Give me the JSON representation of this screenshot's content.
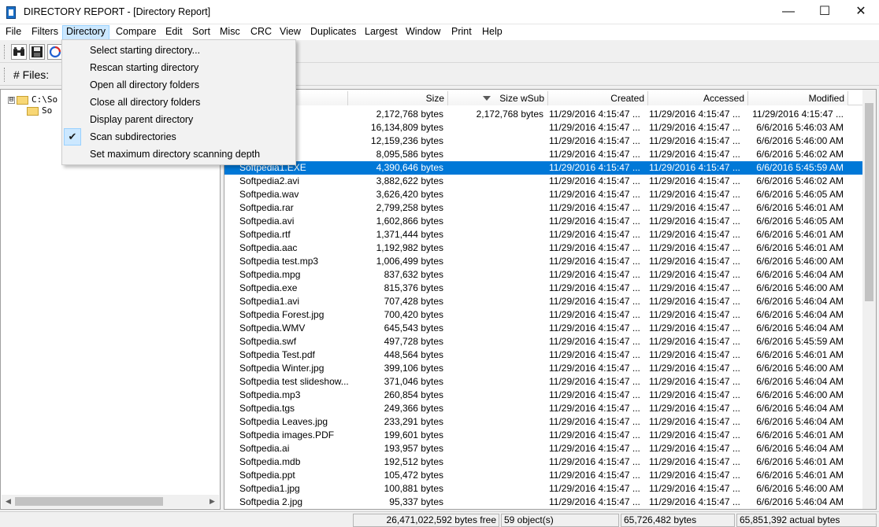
{
  "window": {
    "title": "DIRECTORY REPORT - [Directory Report]",
    "minimize": "—",
    "maximize": "☐",
    "close": "✕"
  },
  "menubar": {
    "items": [
      "File",
      "Filters",
      "Directory",
      "Compare",
      "Edit",
      "Sort",
      "Misc",
      "CRC",
      "View",
      "Duplicates",
      "Largest",
      "Window",
      "Print",
      "Help"
    ],
    "active": "Directory"
  },
  "toolbar": {
    "buttons": [
      "binoculars-icon",
      "save-icon",
      "refresh-icon"
    ]
  },
  "files_bar": {
    "label": "# Files:"
  },
  "directory_menu": {
    "items": [
      "Select starting directory...",
      "Rescan starting directory",
      "Open all directory folders",
      "Close all directory folders",
      "Display parent directory",
      "Scan subdirectories",
      "Set maximum directory scanning depth"
    ],
    "checked_item": "Scan subdirectories"
  },
  "tree": {
    "root": "C:\\So",
    "child": "So",
    "expander": "⊟"
  },
  "list": {
    "columns": [
      "Size",
      "Size wSub",
      "Created",
      "Accessed",
      "Modified"
    ],
    "sorted_column": "Size wSub",
    "selected_index": 4,
    "rows": [
      {
        "name": "",
        "size": "2,172,768 bytes",
        "sub": "2,172,768 bytes",
        "created": "11/29/2016 4:15:47 ...",
        "accessed": "11/29/2016 4:15:47 ...",
        "modified": "11/29/2016 4:15:47 ..."
      },
      {
        "name": "",
        "size": "16,134,809 bytes",
        "sub": "",
        "created": "11/29/2016 4:15:47 ...",
        "accessed": "11/29/2016 4:15:47 ...",
        "modified": "6/6/2016 5:46:03 AM"
      },
      {
        "name": "",
        "size": "12,159,236 bytes",
        "sub": "",
        "created": "11/29/2016 4:15:47 ...",
        "accessed": "11/29/2016 4:15:47 ...",
        "modified": "6/6/2016 5:46:00 AM"
      },
      {
        "name": "",
        "size": "8,095,586 bytes",
        "sub": "",
        "created": "11/29/2016 4:15:47 ...",
        "accessed": "11/29/2016 4:15:47 ...",
        "modified": "6/6/2016 5:46:02 AM"
      },
      {
        "name": "Softpedia1.EXE",
        "size": "4,390,646 bytes",
        "sub": "",
        "created": "11/29/2016 4:15:47 ...",
        "accessed": "11/29/2016 4:15:47 ...",
        "modified": "6/6/2016 5:45:59 AM"
      },
      {
        "name": "Softpedia2.avi",
        "size": "3,882,622 bytes",
        "sub": "",
        "created": "11/29/2016 4:15:47 ...",
        "accessed": "11/29/2016 4:15:47 ...",
        "modified": "6/6/2016 5:46:02 AM"
      },
      {
        "name": "Softpedia.wav",
        "size": "3,626,420 bytes",
        "sub": "",
        "created": "11/29/2016 4:15:47 ...",
        "accessed": "11/29/2016 4:15:47 ...",
        "modified": "6/6/2016 5:46:05 AM"
      },
      {
        "name": "Softpedia.rar",
        "size": "2,799,258 bytes",
        "sub": "",
        "created": "11/29/2016 4:15:47 ...",
        "accessed": "11/29/2016 4:15:47 ...",
        "modified": "6/6/2016 5:46:01 AM"
      },
      {
        "name": "Softpedia.avi",
        "size": "1,602,866 bytes",
        "sub": "",
        "created": "11/29/2016 4:15:47 ...",
        "accessed": "11/29/2016 4:15:47 ...",
        "modified": "6/6/2016 5:46:05 AM"
      },
      {
        "name": "Softpedia.rtf",
        "size": "1,371,444 bytes",
        "sub": "",
        "created": "11/29/2016 4:15:47 ...",
        "accessed": "11/29/2016 4:15:47 ...",
        "modified": "6/6/2016 5:46:01 AM"
      },
      {
        "name": "Softpedia.aac",
        "size": "1,192,982 bytes",
        "sub": "",
        "created": "11/29/2016 4:15:47 ...",
        "accessed": "11/29/2016 4:15:47 ...",
        "modified": "6/6/2016 5:46:01 AM"
      },
      {
        "name": "Softpedia test.mp3",
        "size": "1,006,499 bytes",
        "sub": "",
        "created": "11/29/2016 4:15:47 ...",
        "accessed": "11/29/2016 4:15:47 ...",
        "modified": "6/6/2016 5:46:00 AM"
      },
      {
        "name": "Softpedia.mpg",
        "size": "837,632 bytes",
        "sub": "",
        "created": "11/29/2016 4:15:47 ...",
        "accessed": "11/29/2016 4:15:47 ...",
        "modified": "6/6/2016 5:46:04 AM"
      },
      {
        "name": "Softpedia.exe",
        "size": "815,376 bytes",
        "sub": "",
        "created": "11/29/2016 4:15:47 ...",
        "accessed": "11/29/2016 4:15:47 ...",
        "modified": "6/6/2016 5:46:00 AM"
      },
      {
        "name": "Softpedia1.avi",
        "size": "707,428 bytes",
        "sub": "",
        "created": "11/29/2016 4:15:47 ...",
        "accessed": "11/29/2016 4:15:47 ...",
        "modified": "6/6/2016 5:46:04 AM"
      },
      {
        "name": "Softpedia Forest.jpg",
        "size": "700,420 bytes",
        "sub": "",
        "created": "11/29/2016 4:15:47 ...",
        "accessed": "11/29/2016 4:15:47 ...",
        "modified": "6/6/2016 5:46:04 AM"
      },
      {
        "name": "Softpedia.WMV",
        "size": "645,543 bytes",
        "sub": "",
        "created": "11/29/2016 4:15:47 ...",
        "accessed": "11/29/2016 4:15:47 ...",
        "modified": "6/6/2016 5:46:04 AM"
      },
      {
        "name": "Softpedia.swf",
        "size": "497,728 bytes",
        "sub": "",
        "created": "11/29/2016 4:15:47 ...",
        "accessed": "11/29/2016 4:15:47 ...",
        "modified": "6/6/2016 5:45:59 AM"
      },
      {
        "name": "Softpedia Test.pdf",
        "size": "448,564 bytes",
        "sub": "",
        "created": "11/29/2016 4:15:47 ...",
        "accessed": "11/29/2016 4:15:47 ...",
        "modified": "6/6/2016 5:46:01 AM"
      },
      {
        "name": "Softpedia Winter.jpg",
        "size": "399,106 bytes",
        "sub": "",
        "created": "11/29/2016 4:15:47 ...",
        "accessed": "11/29/2016 4:15:47 ...",
        "modified": "6/6/2016 5:46:00 AM"
      },
      {
        "name": "Softpedia test slideshow...",
        "size": "371,046 bytes",
        "sub": "",
        "created": "11/29/2016 4:15:47 ...",
        "accessed": "11/29/2016 4:15:47 ...",
        "modified": "6/6/2016 5:46:04 AM"
      },
      {
        "name": "Softpedia.mp3",
        "size": "260,854 bytes",
        "sub": "",
        "created": "11/29/2016 4:15:47 ...",
        "accessed": "11/29/2016 4:15:47 ...",
        "modified": "6/6/2016 5:46:00 AM"
      },
      {
        "name": "Softpedia.tgs",
        "size": "249,366 bytes",
        "sub": "",
        "created": "11/29/2016 4:15:47 ...",
        "accessed": "11/29/2016 4:15:47 ...",
        "modified": "6/6/2016 5:46:04 AM"
      },
      {
        "name": "Softpedia Leaves.jpg",
        "size": "233,291 bytes",
        "sub": "",
        "created": "11/29/2016 4:15:47 ...",
        "accessed": "11/29/2016 4:15:47 ...",
        "modified": "6/6/2016 5:46:04 AM"
      },
      {
        "name": "Softpedia images.PDF",
        "size": "199,601 bytes",
        "sub": "",
        "created": "11/29/2016 4:15:47 ...",
        "accessed": "11/29/2016 4:15:47 ...",
        "modified": "6/6/2016 5:46:01 AM"
      },
      {
        "name": "Softpedia.ai",
        "size": "193,957 bytes",
        "sub": "",
        "created": "11/29/2016 4:15:47 ...",
        "accessed": "11/29/2016 4:15:47 ...",
        "modified": "6/6/2016 5:46:04 AM"
      },
      {
        "name": "Softpedia.mdb",
        "size": "192,512 bytes",
        "sub": "",
        "created": "11/29/2016 4:15:47 ...",
        "accessed": "11/29/2016 4:15:47 ...",
        "modified": "6/6/2016 5:46:01 AM"
      },
      {
        "name": "Softpedia.ppt",
        "size": "105,472 bytes",
        "sub": "",
        "created": "11/29/2016 4:15:47 ...",
        "accessed": "11/29/2016 4:15:47 ...",
        "modified": "6/6/2016 5:46:01 AM"
      },
      {
        "name": "Softpedia1.jpg",
        "size": "100,881 bytes",
        "sub": "",
        "created": "11/29/2016 4:15:47 ...",
        "accessed": "11/29/2016 4:15:47 ...",
        "modified": "6/6/2016 5:46:00 AM"
      },
      {
        "name": "Softpedia 2.jpg",
        "size": "95,337 bytes",
        "sub": "",
        "created": "11/29/2016 4:15:47 ...",
        "accessed": "11/29/2016 4:15:47 ...",
        "modified": "6/6/2016 5:46:04 AM"
      }
    ]
  },
  "statusbar": {
    "free": "26,471,022,592 bytes free",
    "objects": "59 object(s)",
    "bytes": "65,726,482 bytes",
    "actual": "65,851,392 actual bytes"
  },
  "colors": {
    "selection": "#0078d7",
    "menu_highlight": "#cce8ff"
  }
}
